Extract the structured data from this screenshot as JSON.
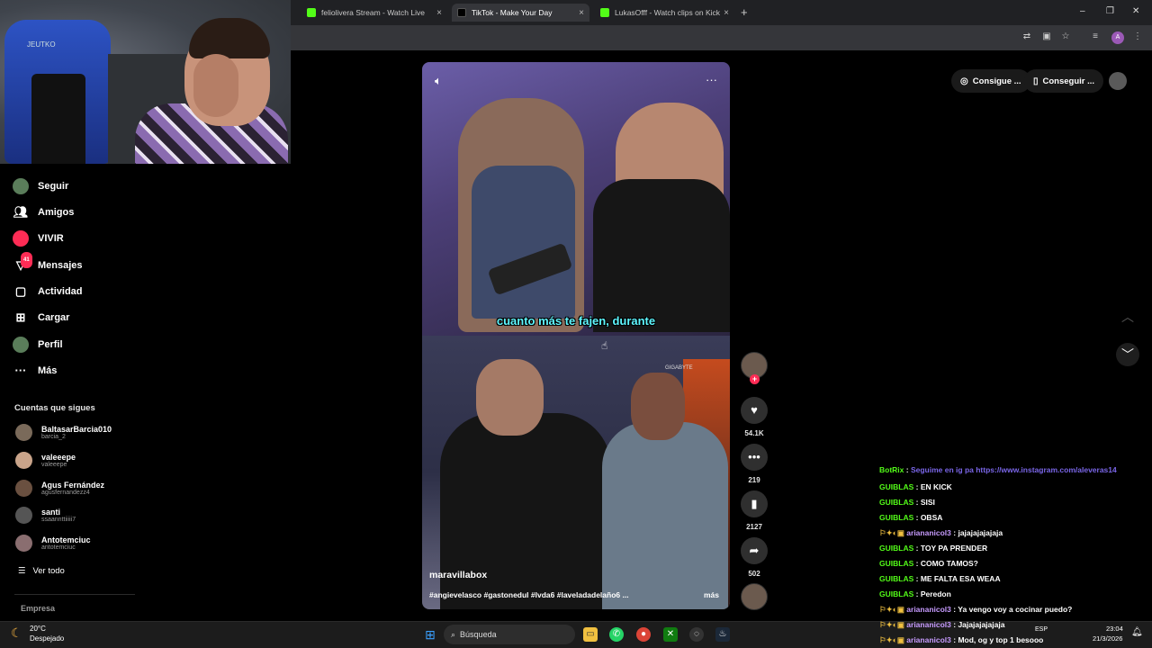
{
  "browser": {
    "tabs": [
      {
        "label": "feliolivera Stream - Watch Live"
      },
      {
        "label": "TikTok - Make Your Day"
      },
      {
        "label": "LukasOfff - Watch clips on Kick"
      }
    ],
    "new_tab": "+",
    "close": "×",
    "window_controls": {
      "minimize": "–",
      "restore": "❐",
      "close": "✕"
    }
  },
  "webcam": {
    "chair_logo": "JEUTKO"
  },
  "sidebar": {
    "nav": [
      {
        "label": "Seguir",
        "icon": "following-icon"
      },
      {
        "label": "Amigos",
        "icon": "friends-icon"
      },
      {
        "label": "VIVIR",
        "icon": "live-icon"
      },
      {
        "label": "Mensajes",
        "icon": "messages-icon",
        "badge": "41"
      },
      {
        "label": "Actividad",
        "icon": "activity-icon"
      },
      {
        "label": "Cargar",
        "icon": "upload-icon"
      },
      {
        "label": "Perfil",
        "icon": "profile-icon"
      },
      {
        "label": "Más",
        "icon": "more-icon"
      }
    ],
    "following_title": "Cuentas que sigues",
    "following": [
      {
        "name": "BaltasarBarcia010",
        "handle": "barcia_2"
      },
      {
        "name": "valeeepe",
        "handle": "valeeepe"
      },
      {
        "name": "Agus Fernández",
        "handle": "agusfernandezz4"
      },
      {
        "name": "santi",
        "handle": "ssaannttiiiii7"
      },
      {
        "name": "Antotemciuc",
        "handle": "antotemciuc"
      }
    ],
    "see_all": "Ver todo",
    "empresa": "Empresa"
  },
  "header": {
    "get_coins": "Consigue ...",
    "get_app": "Conseguir ..."
  },
  "video": {
    "caption": "cuanto más te fajen, durante",
    "author": "maravillabox",
    "hashtags": "#angievelasco #gastonedul #lvda6 #laveladadelaño6 ...",
    "more": "más",
    "chair_brand": "GIGABYTE"
  },
  "actions": {
    "likes": "54.1K",
    "comments": "219",
    "saves": "2127",
    "shares": "502"
  },
  "chat": [
    {
      "user": "BotRix",
      "text": "Seguime en ig pa https://www.instagram.com/aleveras14",
      "cls": "u1"
    },
    {
      "user": "GUIBLAS",
      "text": "EN KICK",
      "cls": "u1"
    },
    {
      "user": "GUIBLAS",
      "text": "SISI",
      "cls": "u1"
    },
    {
      "user": "GUIBLAS",
      "text": "OBSA",
      "cls": "u1"
    },
    {
      "user": "ariananicol3",
      "text": "jajajajajajaja",
      "cls": "u2"
    },
    {
      "user": "GUIBLAS",
      "text": "TOY PA PRENDER",
      "cls": "u1"
    },
    {
      "user": "GUIBLAS",
      "text": "COMO TAMOS?",
      "cls": "u1"
    },
    {
      "user": "GUIBLAS",
      "text": "ME FALTA ESA WEAA",
      "cls": "u1"
    },
    {
      "user": "GUIBLAS",
      "text": "Peredon",
      "cls": "u1"
    },
    {
      "user": "ariananicol3",
      "text": "Ya vengo voy a cocinar puedo?",
      "cls": "u2"
    },
    {
      "user": "ariananicol3",
      "text": "Jajajajajajaja",
      "cls": "u2"
    },
    {
      "user": "ariananicol3",
      "text": "Mod, og y top 1 besooo",
      "cls": "u2"
    }
  ],
  "taskbar": {
    "weather_temp": "20°C",
    "weather_desc": "Despejado",
    "search": "Búsqueda",
    "lang": "ESP",
    "time": "23:04",
    "date": "21/3/2026"
  },
  "colors": {
    "tiktok_red": "#fe2c55",
    "kick_green": "#53fc18",
    "caption_cyan": "#5ef6ff"
  }
}
